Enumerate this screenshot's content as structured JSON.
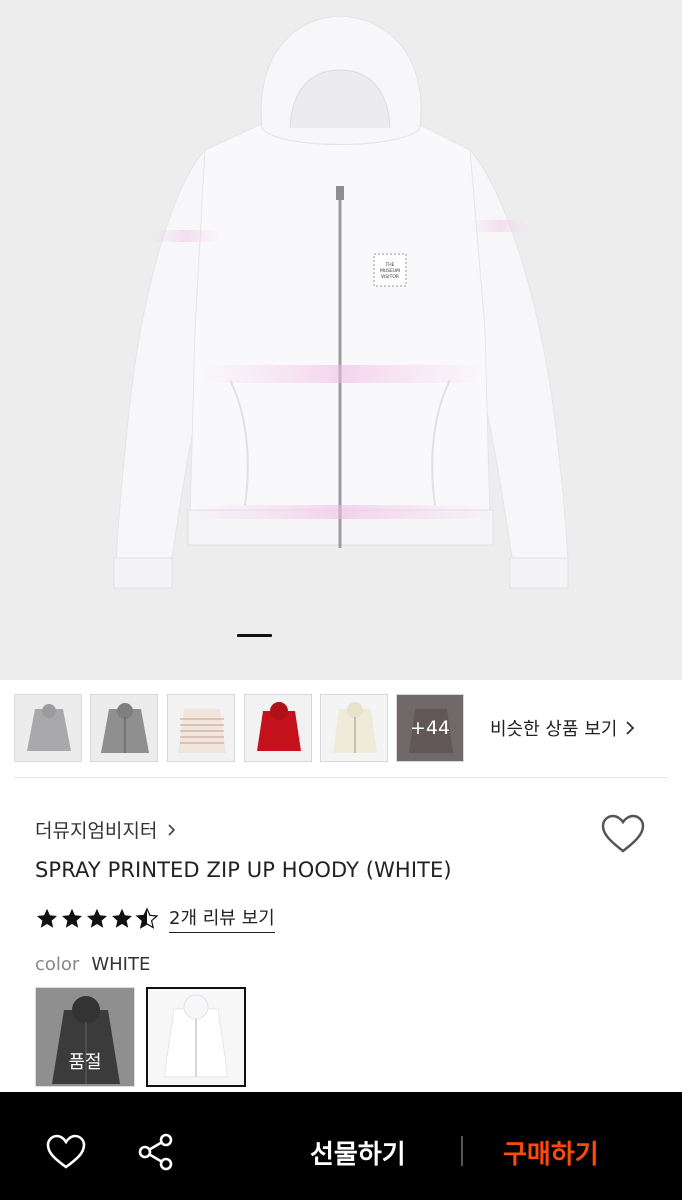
{
  "hero": {
    "alt": "SPRAY PRINTED ZIP UP HOODY (WHITE)",
    "patch_lines": [
      "THE",
      "MUSEUM",
      "VISITOR"
    ]
  },
  "thumbnails": [
    {
      "color": "#a9a9ab",
      "icon": "gray-hoodie"
    },
    {
      "color": "#8f8f90",
      "icon": "charcoal-zip-hoodie"
    },
    {
      "color": "#e9ddd2",
      "icon": "striped-hoodie"
    },
    {
      "color": "#c4121c",
      "icon": "red-hoodie"
    },
    {
      "color": "#f0ebd9",
      "icon": "cream-zip-hoodie"
    }
  ],
  "more_count": "+44",
  "similar_link": "비슷한 상품 보기",
  "brand": "더뮤지엄비지터",
  "product_name": "SPRAY PRINTED ZIP UP HOODY (WHITE)",
  "rating": {
    "value": 4.5,
    "max": 5
  },
  "review_link": "2개 리뷰 보기",
  "color": {
    "label": "color",
    "value": "WHITE"
  },
  "swatches": [
    {
      "name": "BLACK",
      "badge": "품절"
    },
    {
      "name": "WHITE"
    }
  ],
  "bottom_bar": {
    "gift_label": "선물하기",
    "buy_label": "구매하기",
    "buy_color": "#ff4b0a"
  }
}
